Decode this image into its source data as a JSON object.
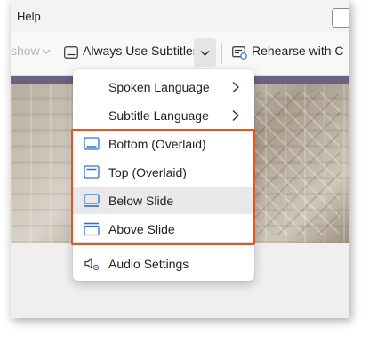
{
  "menubar": {
    "help_label": "Help"
  },
  "ribbon": {
    "slideshow_partial": "show",
    "subtitles_label": "Always Use Subtitles",
    "rehearse_label": "Rehearse with C"
  },
  "dropdown": {
    "items": [
      {
        "label": "Spoken Language",
        "icon": "none",
        "has_submenu": true
      },
      {
        "label": "Subtitle Language",
        "icon": "none",
        "has_submenu": true
      },
      {
        "label": "Bottom (Overlaid)",
        "icon": "subtitle-bottom-overlaid-icon"
      },
      {
        "label": "Top (Overlaid)",
        "icon": "subtitle-top-overlaid-icon"
      },
      {
        "label": "Below Slide",
        "icon": "subtitle-below-slide-icon",
        "selected": true
      },
      {
        "label": "Above Slide",
        "icon": "subtitle-above-slide-icon"
      },
      {
        "label": "Audio Settings",
        "icon": "audio-settings-icon"
      }
    ]
  },
  "colors": {
    "highlight_border": "#e8531e",
    "icon_blue": "#2f6fd1",
    "slide_band": "#6e6082"
  }
}
